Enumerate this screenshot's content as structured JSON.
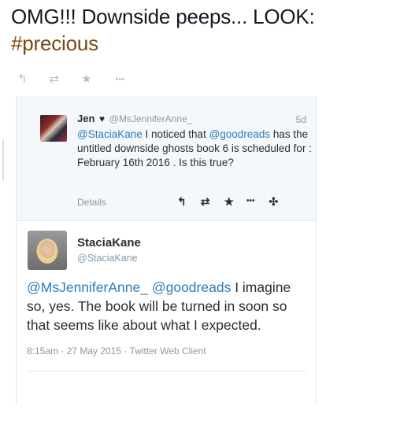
{
  "headline": {
    "line1": "OMG!!! Downside peeps... LOOK:",
    "hashtag": "#precious"
  },
  "top_actions": [
    {
      "icon": "reply-icon",
      "glyph": "↰"
    },
    {
      "icon": "retweet-icon",
      "glyph": "⇄"
    },
    {
      "icon": "favorite-star-icon",
      "glyph": "★"
    },
    {
      "icon": "more-dots-icon",
      "glyph": "•••"
    }
  ],
  "quoted_tweet": {
    "name": "Jen",
    "heart": "♥",
    "handle": "@MsJenniferAnne_",
    "time": "5d",
    "mention": "@StaciaKane",
    "text_a": " I noticed that ",
    "mention2": "@goodreads",
    "text_b": " has the untitled downside ghosts book 6 is scheduled for : February 16th 2016 . Is this true?",
    "details_label": "Details",
    "actions": [
      {
        "icon": "reply-icon",
        "glyph": "↰"
      },
      {
        "icon": "retweet-icon",
        "glyph": "⇄"
      },
      {
        "icon": "favorite-star-icon",
        "glyph": "★"
      },
      {
        "icon": "more-dots-icon",
        "glyph": "•••"
      },
      {
        "icon": "expand-icon",
        "glyph": "✣"
      }
    ]
  },
  "main_tweet": {
    "name": "StaciaKane",
    "handle": "@StaciaKane",
    "mention1": "@MsJenniferAnne_",
    "mention2": "@goodreads",
    "text": " I imagine so, yes. The book will be turned in soon so that seems like about what I expected.",
    "meta": "8:15am · 27 May 2015 · Twitter Web Client"
  }
}
